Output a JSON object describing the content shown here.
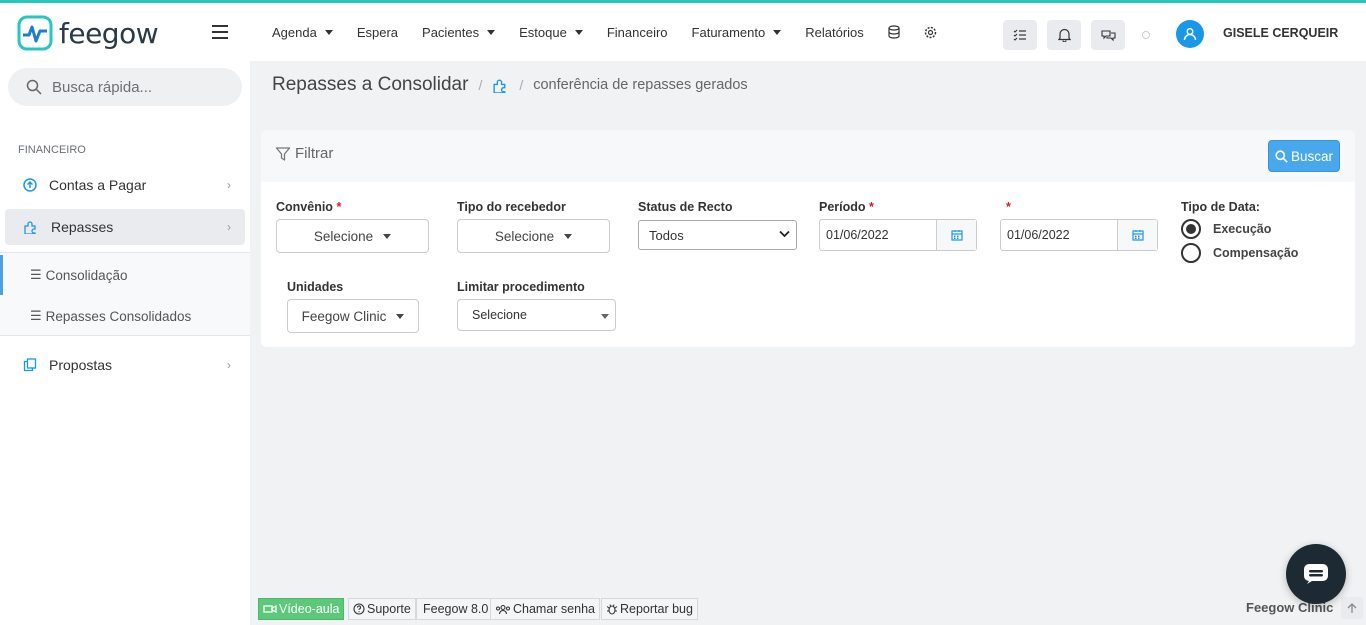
{
  "app": {
    "name": "feegow"
  },
  "search": {
    "placeholder": "Busca rápida..."
  },
  "sidebar": {
    "section_title": "FINANCEIRO",
    "items": [
      {
        "label": "Contas a Pagar"
      },
      {
        "label": "Repasses"
      },
      {
        "label": "Propostas"
      }
    ],
    "sub_items": [
      {
        "label": "Consolidação"
      },
      {
        "label": "Repasses Consolidados"
      }
    ]
  },
  "topnav": {
    "menu": [
      {
        "label": "Agenda",
        "dropdown": true
      },
      {
        "label": "Espera",
        "dropdown": false
      },
      {
        "label": "Pacientes",
        "dropdown": true
      },
      {
        "label": "Estoque",
        "dropdown": true
      },
      {
        "label": "Financeiro",
        "dropdown": false
      },
      {
        "label": "Faturamento",
        "dropdown": true
      },
      {
        "label": "Relatórios",
        "dropdown": false
      }
    ],
    "user_name": "GISELE CERQUEIR"
  },
  "breadcrumb": {
    "title": "Repasses a Consolidar",
    "sub": "conferência de repasses gerados"
  },
  "filter": {
    "title": "Filtrar",
    "search_button": "Buscar",
    "convenio": {
      "label": "Convênio",
      "value": "Selecione"
    },
    "tipo_recebedor": {
      "label": "Tipo do recebedor",
      "value": "Selecione"
    },
    "status_recto": {
      "label": "Status de Recto",
      "value": "Todos"
    },
    "periodo": {
      "label": "Período",
      "start": "01/06/2022",
      "end": "01/06/2022"
    },
    "tipo_data": {
      "label": "Tipo de Data:",
      "options": [
        {
          "label": "Execução",
          "selected": true
        },
        {
          "label": "Compensação",
          "selected": false
        }
      ]
    },
    "unidades": {
      "label": "Unidades",
      "value": "Feegow Clinic"
    },
    "limitar_procedimento": {
      "label": "Limitar procedimento",
      "value": "Selecione"
    }
  },
  "footer": {
    "video_aula": "Vídeo-aula",
    "suporte": "Suporte",
    "version": "Feegow 8.0",
    "chamar_senha": "Chamar senha",
    "reportar_bug": "Reportar bug",
    "brand": "Feegow Clinic"
  },
  "colors": {
    "accent": "#25c7c0",
    "primary": "#49a8ec",
    "required": "#e0191b"
  }
}
